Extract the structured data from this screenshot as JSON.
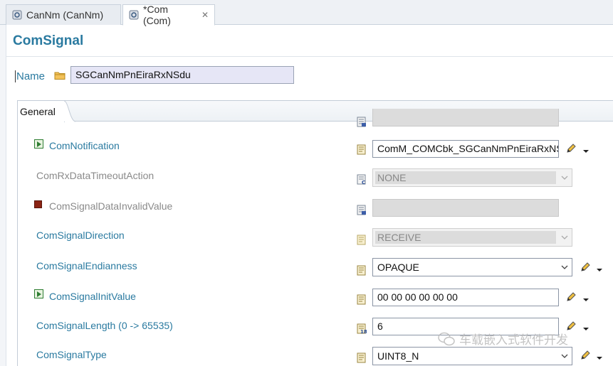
{
  "tabs": [
    {
      "label": "CanNm (CanNm)",
      "active": false
    },
    {
      "label": "*Com (Com)",
      "active": true,
      "close": "✕"
    }
  ],
  "page_title": "ComSignal",
  "name": {
    "label": "Name",
    "value": "SGCanNmPnEiraRxNSdu"
  },
  "section_tab": "General",
  "rows": {
    "notification": {
      "label": "ComNotification",
      "value": "ComM_COMCbk_SGCanNmPnEiraRxNSdu"
    },
    "timeout_action": {
      "label": "ComRxDataTimeoutAction",
      "value": "NONE"
    },
    "invalid_value": {
      "label": "ComSignalDataInvalidValue",
      "value": ""
    },
    "direction": {
      "label": "ComSignalDirection",
      "value": "RECEIVE"
    },
    "endianness": {
      "label": "ComSignalEndianness",
      "value": "OPAQUE"
    },
    "init_value": {
      "label": "ComSignalInitValue",
      "value": "00 00 00 00 00 00"
    },
    "length": {
      "label": "ComSignalLength (0 -> 65535)",
      "value": "6"
    },
    "type": {
      "label": "ComSignalType",
      "value": "UINT8_N"
    }
  },
  "watermark": "车载嵌入式软件开发",
  "colors": {
    "label_blue": "#2a7aa0",
    "disabled_gray": "#8a8a8a"
  }
}
